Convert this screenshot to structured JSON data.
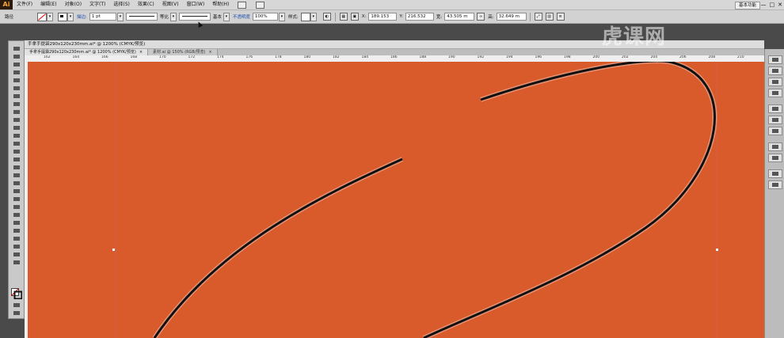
{
  "app": {
    "logo": "Ai",
    "workspace": "基本功能",
    "window_controls": [
      "—",
      "□",
      "✕"
    ]
  },
  "menu": [
    "文件(F)",
    "编辑(E)",
    "对象(O)",
    "文字(T)",
    "选择(S)",
    "效果(C)",
    "视图(V)",
    "窗口(W)",
    "帮助(H)"
  ],
  "control_bar": {
    "selection_label": "路径",
    "stroke_label": "描边:",
    "stroke_weight": "1 pt",
    "profile_label": "等比",
    "brush_label": "基本",
    "opacity_label": "不透明度",
    "opacity_value": "100%",
    "style_label": "样式:",
    "x_label": "X:",
    "x_value": "189.153",
    "y_label": "Y:",
    "y_value": "216.532",
    "w_label": "宽:",
    "w_value": "43.505 m",
    "h_label": "高:",
    "h_value": "32.649 m"
  },
  "document": {
    "title": "手拿手提袋290x120x230mm.ai* @ 1200% (CMYK/预览)",
    "tabs": [
      {
        "label": "手拿手提袋290x120x230mm.ai* @ 1200% (CMYK/预览)",
        "active": true
      },
      {
        "label": "素材.ai @ 150% (RGB/预览)",
        "active": false
      }
    ]
  },
  "ruler": {
    "ticks": [
      "162",
      "164",
      "166",
      "168",
      "170",
      "172",
      "174",
      "176",
      "178",
      "180",
      "182",
      "184",
      "186",
      "188",
      "190",
      "192",
      "194",
      "196",
      "198",
      "200",
      "202",
      "204",
      "206",
      "208",
      "210"
    ]
  },
  "canvas": {
    "background": "#d95a2b"
  },
  "watermark": "虎课网"
}
